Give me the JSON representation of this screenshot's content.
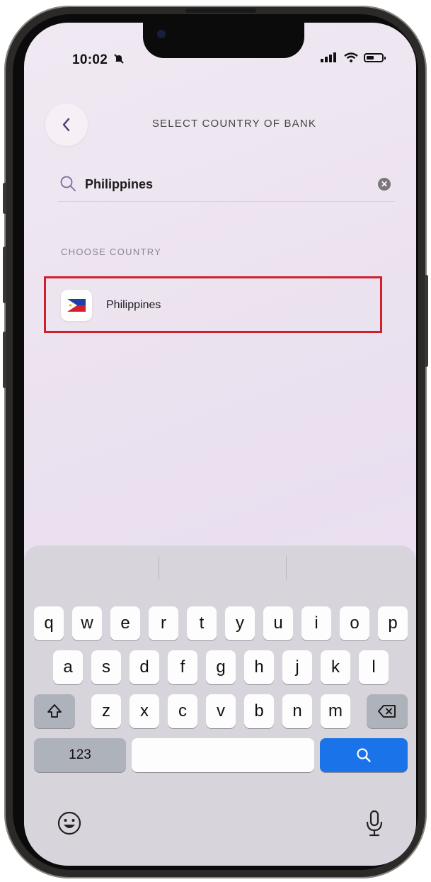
{
  "status_bar": {
    "time": "10:02",
    "signal": "ııl",
    "wifi_icon": "wifi-icon",
    "battery_icon": "battery-icon"
  },
  "header": {
    "title": "SELECT COUNTRY OF BANK",
    "back_icon": "chevron-left-icon"
  },
  "search": {
    "value": "Philippines",
    "clear_icon": "clear-circle-icon"
  },
  "section": {
    "label": "CHOOSE COUNTRY"
  },
  "results": [
    {
      "label": "Philippines",
      "flag": "philippines-flag"
    }
  ],
  "keyboard": {
    "row1": [
      "q",
      "w",
      "e",
      "r",
      "t",
      "y",
      "u",
      "i",
      "o",
      "p"
    ],
    "row2": [
      "a",
      "s",
      "d",
      "f",
      "g",
      "h",
      "j",
      "k",
      "l"
    ],
    "row3": [
      "z",
      "x",
      "c",
      "v",
      "b",
      "n",
      "m"
    ],
    "numbers_key": "123",
    "shift_icon": "shift-icon",
    "delete_icon": "delete-icon",
    "search_icon": "search-icon",
    "emoji_icon": "emoji-icon",
    "mic_icon": "microphone-icon"
  },
  "colors": {
    "highlight": "#d21f2e",
    "accent_key": "#1a73e8"
  }
}
